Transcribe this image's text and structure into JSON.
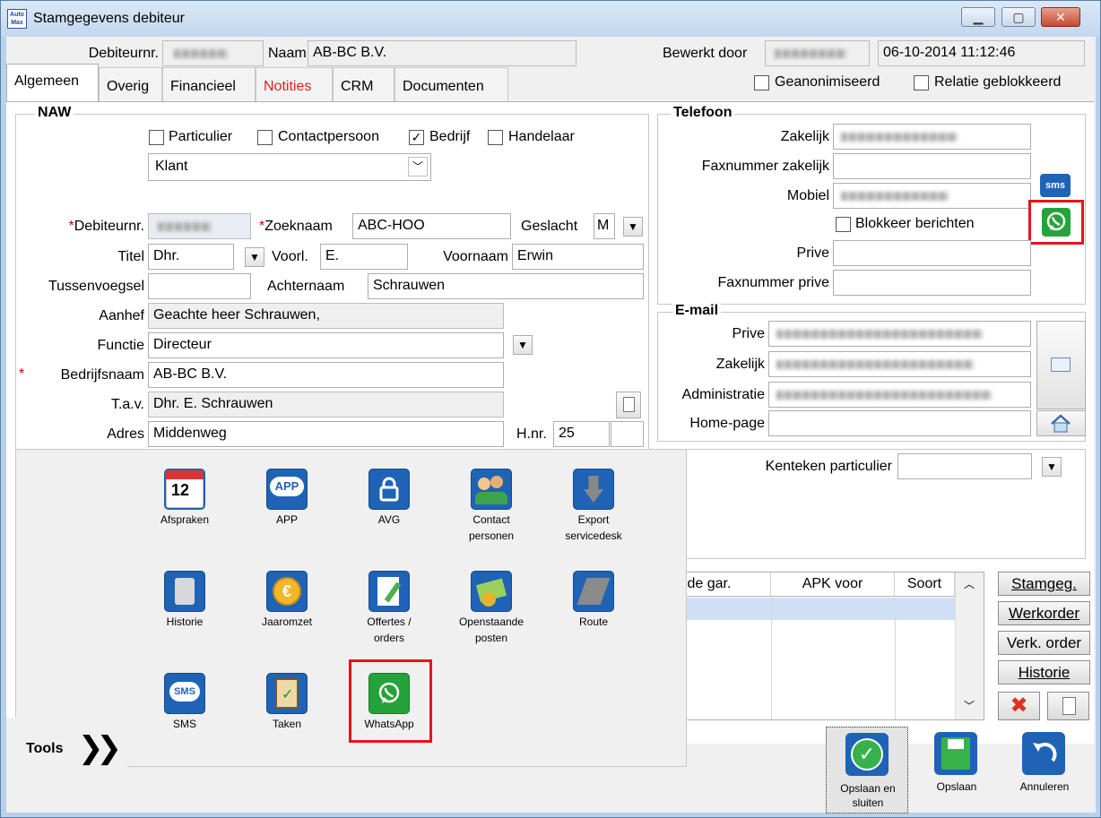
{
  "window": {
    "title": "Stamgegevens debiteur",
    "logo_text": "Auto\nMax"
  },
  "header": {
    "debiteurnr_label": "Debiteurnr.",
    "naam_label": "Naam",
    "naam_value": "AB-BC B.V.",
    "bewerkt_door_label": "Bewerkt door",
    "datetime": "06-10-2014 11:12:46"
  },
  "tabs": [
    {
      "label": "Algemeen",
      "active": true
    },
    {
      "label": "Overig"
    },
    {
      "label": "Financieel"
    },
    {
      "label": "Notities",
      "color": "#e02020"
    },
    {
      "label": "CRM"
    },
    {
      "label": "Documenten"
    }
  ],
  "flags": {
    "geanonimiseerd": "Geanonimiseerd",
    "relatie_geblokkeerd": "Relatie geblokkeerd"
  },
  "naw": {
    "title": "NAW",
    "types": {
      "particulier": "Particulier",
      "contactpersoon": "Contactpersoon",
      "bedrijf": "Bedrijf",
      "handelaar": "Handelaar",
      "bedrijf_checked": "✓"
    },
    "category": "Klant",
    "debiteurnr_label": "Debiteurnr.",
    "zoeknaam_label": "Zoeknaam",
    "zoeknaam_value": "ABC-HOO",
    "geslacht_label": "Geslacht",
    "geslacht_value": "M",
    "titel_label": "Titel",
    "titel_value": "Dhr.",
    "voorl_label": "Voorl.",
    "voorl_value": "E.",
    "voornaam_label": "Voornaam",
    "voornaam_value": "Erwin",
    "tussenvoegsel_label": "Tussenvoegsel",
    "achternaam_label": "Achternaam",
    "achternaam_value": "Schrauwen",
    "aanhef_label": "Aanhef",
    "aanhef_value": "Geachte heer Schrauwen,",
    "functie_label": "Functie",
    "functie_value": "Directeur",
    "bedrijfsnaam_label": "Bedrijfsnaam",
    "bedrijfsnaam_value": "AB-BC B.V.",
    "tav_label": "T.a.v.",
    "tav_value": "Dhr. E. Schrauwen",
    "adres_label": "Adres",
    "adres_value": "Middenweg",
    "hnr_label": "H.nr.",
    "hnr_value": "25",
    "required_mark": "*"
  },
  "telefoon": {
    "title": "Telefoon",
    "zakelijk": "Zakelijk",
    "fax_zakelijk": "Faxnummer zakelijk",
    "mobiel": "Mobiel",
    "blokkeer": "Blokkeer berichten",
    "prive": "Prive",
    "fax_prive": "Faxnummer prive",
    "sms_icon_text": "sms"
  },
  "email": {
    "title": "E-mail",
    "prive": "Prive",
    "zakelijk": "Zakelijk",
    "administratie": "Administratie",
    "homepage": "Home-page"
  },
  "kenteken": {
    "label": "Kenteken particulier"
  },
  "grid": {
    "columns": [
      "inde gar.",
      "APK voor",
      "Soort"
    ]
  },
  "side_buttons": [
    "Stamgeg.",
    "Werkorder",
    "Verk. order",
    "Historie"
  ],
  "tools": {
    "label": "Tools",
    "items": [
      {
        "label": "Afspraken",
        "icon": "calendar-icon",
        "badge": "12"
      },
      {
        "label": "APP",
        "icon": "app-icon",
        "badge": "APP"
      },
      {
        "label": "AVG",
        "icon": "lock-icon"
      },
      {
        "label": "Contact\npersonen",
        "icon": "contacts-icon"
      },
      {
        "label": "Export\nservicedesk",
        "icon": "export-icon"
      },
      {
        "label": "Historie",
        "icon": "scroll-icon"
      },
      {
        "label": "Jaaromzet",
        "icon": "euro-coin-icon",
        "badge": "€"
      },
      {
        "label": "Offertes /\norders",
        "icon": "document-edit-icon"
      },
      {
        "label": "Openstaande\nposten",
        "icon": "money-icon"
      },
      {
        "label": "Route",
        "icon": "road-icon"
      },
      {
        "label": "SMS",
        "icon": "sms-icon",
        "badge": "SMS"
      },
      {
        "label": "Taken",
        "icon": "clipboard-icon"
      },
      {
        "label": "WhatsApp",
        "icon": "whatsapp-icon"
      }
    ]
  },
  "footer": {
    "save_close": "Opslaan en\nsluiten",
    "save": "Opslaan",
    "cancel": "Annuleren"
  },
  "colors": {
    "accent_red": "#e3151a",
    "whatsapp": "#25a33a",
    "icon_blue": "#1e63b6"
  }
}
